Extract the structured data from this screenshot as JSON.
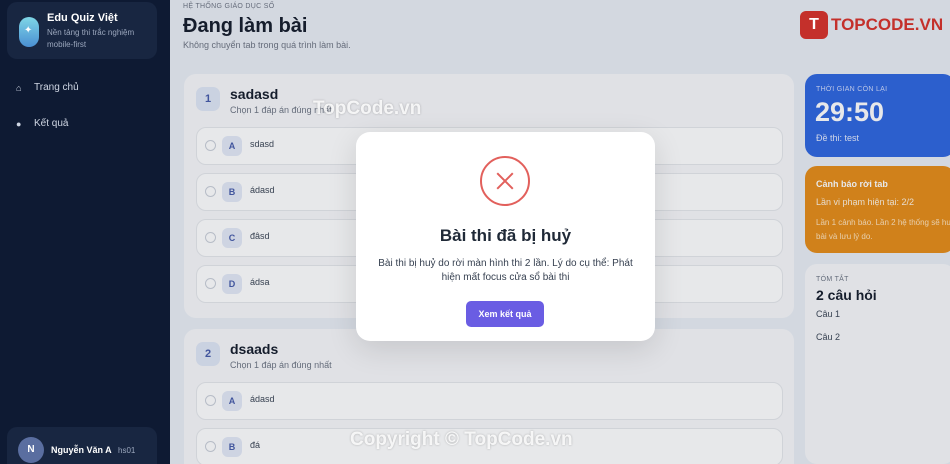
{
  "brand": {
    "title": "Edu Quiz Việt",
    "subtitle": "Nền tảng thi trắc nghiệm mobile-first"
  },
  "nav": [
    {
      "label": "Trang chủ",
      "icon": "home-icon"
    },
    {
      "label": "Kết quả",
      "icon": "trophy-icon"
    }
  ],
  "user": {
    "initial": "N",
    "name": "Nguyễn Văn A",
    "code": "hs01"
  },
  "header": {
    "eyebrow": "HỆ THỐNG GIÁO DỤC SỐ",
    "title": "Đang làm bài",
    "subtitle": "Không chuyển tab trong quá trình làm bài."
  },
  "questions": [
    {
      "number": "1",
      "title": "sadasd",
      "hint": "Chọn 1 đáp án đúng nhất",
      "options": [
        {
          "letter": "A",
          "text": "sdasd"
        },
        {
          "letter": "B",
          "text": "ádasd"
        },
        {
          "letter": "C",
          "text": "đâsd"
        },
        {
          "letter": "D",
          "text": "ádsa"
        }
      ]
    },
    {
      "number": "2",
      "title": "dsaads",
      "hint": "Chọn 1 đáp án đúng nhất",
      "options": [
        {
          "letter": "A",
          "text": "ádasd"
        },
        {
          "letter": "B",
          "text": "đá"
        }
      ]
    }
  ],
  "timer": {
    "label": "THỜI GIAN CÒN LẠI",
    "value": "29:50",
    "exam": "Đề thi: test"
  },
  "warning": {
    "title": "Cảnh báo rời tab",
    "count": "Lần vi phạm hiện tại: 2/2",
    "description": "Lần 1 cảnh báo. Lần 2 hệ thống sẽ huỷ bài và lưu lý do."
  },
  "summary": {
    "label": "TÓM TẮT",
    "count": "2 câu hỏi",
    "items": [
      "Câu 1",
      "Câu 2"
    ]
  },
  "modal": {
    "title": "Bài thi đã bị huỷ",
    "body": "Bài thi bị huỷ do rời màn hình thi 2 lần. Lý do cụ thể: Phát hiện mất focus cửa sổ bài thi",
    "button": "Xem kết quả",
    "icon": "close-circle-icon"
  },
  "watermarks": {
    "logo_mark": "T",
    "logo_text": "TOPCODE.VN",
    "center": "TopCode.vn",
    "bottom": "Copyright © TopCode.vn"
  },
  "colors": {
    "accent": "#6a5de3",
    "timer": "#2b63df",
    "warning": "#e58a14",
    "danger": "#e2605c",
    "sidebar": "#0e1a33"
  }
}
